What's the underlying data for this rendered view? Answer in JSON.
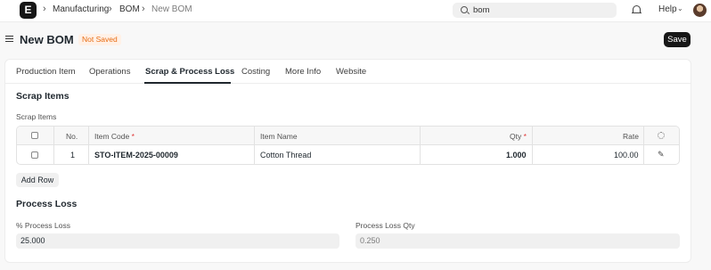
{
  "navbar": {
    "logo": "E",
    "breadcrumbs": [
      "Manufacturing",
      "BOM",
      "New BOM"
    ],
    "search_value": "bom",
    "help_label": "Help"
  },
  "page": {
    "title": "New BOM",
    "status_badge": "Not Saved",
    "save_label": "Save"
  },
  "tabs": [
    "Production Item",
    "Operations",
    "Scrap & Process Loss",
    "Costing",
    "More Info",
    "Website"
  ],
  "active_tab": "Scrap & Process Loss",
  "scrap_section": {
    "title": "Scrap Items",
    "field_label": "Scrap Items",
    "columns": {
      "no": "No.",
      "item_code": "Item Code",
      "item_name": "Item Name",
      "qty": "Qty",
      "rate": "Rate",
      "required_mark": "*"
    },
    "rows": [
      {
        "no": "1",
        "item_code": "STO-ITEM-2025-00009",
        "item_name": "Cotton Thread",
        "qty": "1.000",
        "rate": "100.00"
      }
    ],
    "add_row_label": "Add Row"
  },
  "process_loss": {
    "title": "Process Loss",
    "percent_label": "% Process Loss",
    "percent_value": "25.000",
    "qty_label": "Process Loss Qty",
    "qty_value": "0.250"
  }
}
